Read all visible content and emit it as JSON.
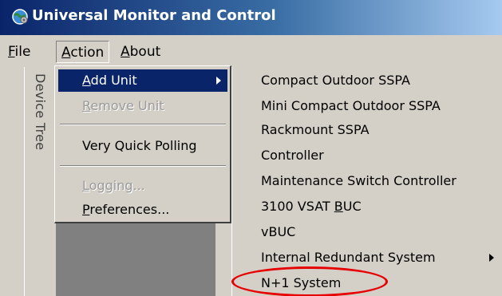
{
  "window": {
    "title": "Universal Monitor and Control",
    "icon": "globe-gear-icon"
  },
  "menubar": {
    "items": [
      {
        "label": "File",
        "mnemonic": "F"
      },
      {
        "label": "Action",
        "mnemonic": "A"
      },
      {
        "label": "About",
        "mnemonic": "A"
      }
    ]
  },
  "device_tree": {
    "label": "Device Tree"
  },
  "action_menu": {
    "items": [
      {
        "label": "Add Unit",
        "highlighted": true,
        "has_submenu": true
      },
      {
        "label": "Remove Unit",
        "disabled": true
      },
      {
        "label": "Very Quick Polling"
      },
      {
        "label": "Logging...",
        "disabled": true
      },
      {
        "label": "Preferences..."
      }
    ]
  },
  "add_unit_submenu": {
    "items": [
      {
        "label": "Compact Outdoor SSPA"
      },
      {
        "label": "Mini Compact Outdoor SSPA"
      },
      {
        "label": "Rackmount SSPA"
      },
      {
        "label": "Controller"
      },
      {
        "label": "Maintenance Switch Controller"
      },
      {
        "label": "3100 VSAT BUC"
      },
      {
        "label": "vBUC"
      },
      {
        "label": "Internal Redundant System",
        "has_submenu": true
      },
      {
        "label": "N+1 System",
        "circled": true
      }
    ]
  },
  "colors": {
    "titlebar_start": "#0a246a",
    "titlebar_end": "#a6caf0",
    "highlight": "#0a246a",
    "annotation_red": "#e60000",
    "face": "#d4d0c8"
  }
}
